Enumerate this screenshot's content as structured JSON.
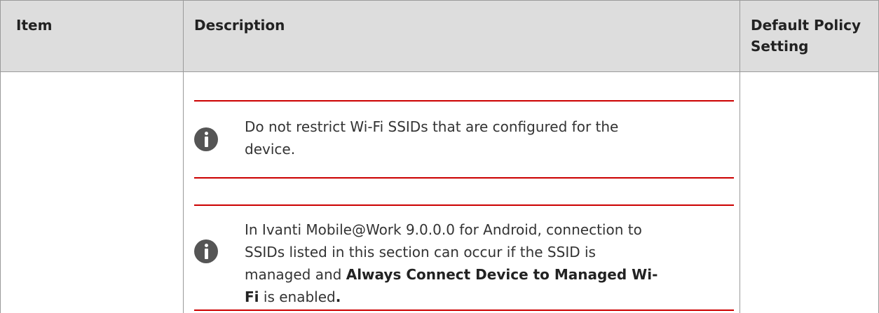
{
  "table": {
    "headers": {
      "item": "Item",
      "description": "Description",
      "default_line1": "Default Policy",
      "default_line2": "Setting"
    }
  },
  "notes": [
    {
      "icon": "info-icon",
      "line1": "Do not restrict Wi-Fi SSIDs that are configured for the",
      "line2": "device."
    },
    {
      "icon": "info-icon",
      "line1": "In Ivanti Mobile@Work 9.0.0.0 for Android, connection to",
      "line2": "SSIDs listed in this section can occur if the SSID is",
      "line3_pre": "managed and ",
      "line3_bold": "Always Connect Device to Managed Wi-",
      "line4_bold": "Fi",
      "line4_post": " is enabled",
      "line4_end": "."
    }
  ],
  "colors": {
    "header_bg": "#dddddd",
    "note_rule": "#cc0000",
    "icon": "#555555",
    "border": "#9a9a9a"
  }
}
